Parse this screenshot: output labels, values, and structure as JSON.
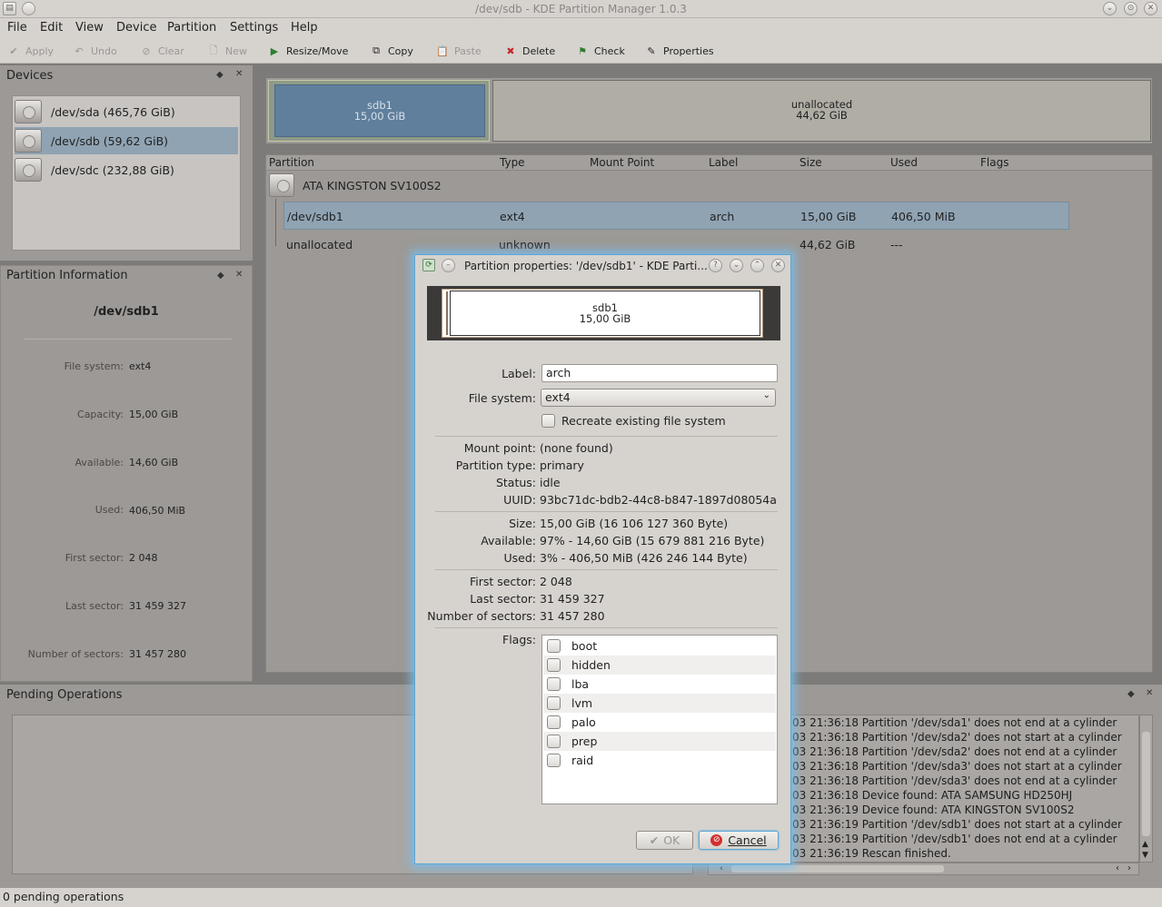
{
  "window": {
    "title": "/dev/sdb - KDE Partition Manager 1.0.3"
  },
  "menu": [
    "File",
    "Edit",
    "View",
    "Device",
    "Partition",
    "Settings",
    "Help"
  ],
  "toolbar": {
    "apply": "Apply",
    "undo": "Undo",
    "clear": "Clear",
    "new": "New",
    "resize": "Resize/Move",
    "copy": "Copy",
    "paste": "Paste",
    "delete": "Delete",
    "check": "Check",
    "properties": "Properties"
  },
  "devices": {
    "title": "Devices",
    "items": [
      "/dev/sda (465,76 GiB)",
      "/dev/sdb (59,62 GiB)",
      "/dev/sdc (232,88 GiB)"
    ]
  },
  "info": {
    "title": "Partition Information",
    "device": "/dev/sdb1",
    "rows": [
      {
        "label": "File system:",
        "value": "ext4"
      },
      {
        "label": "Capacity:",
        "value": "15,00 GiB"
      },
      {
        "label": "Available:",
        "value": "14,60 GiB"
      },
      {
        "label": "Used:",
        "value": "406,50 MiB"
      },
      {
        "label": "First sector:",
        "value": "2 048"
      },
      {
        "label": "Last sector:",
        "value": "31 459 327"
      },
      {
        "label": "Number of sectors:",
        "value": "31 457 280"
      }
    ]
  },
  "graph": {
    "p1_name": "sdb1",
    "p1_size": "15,00 GiB",
    "p2_name": "unallocated",
    "p2_size": "44,62 GiB"
  },
  "table": {
    "headers": [
      "Partition",
      "Type",
      "Mount Point",
      "Label",
      "Size",
      "Used",
      "Flags"
    ],
    "disk": "ATA KINGSTON SV100S2",
    "rows": [
      {
        "partition": "/dev/sdb1",
        "type": "ext4",
        "label": "arch",
        "size": "15,00 GiB",
        "used": "406,50 MiB"
      },
      {
        "partition": "unallocated",
        "type": "unknown",
        "label": "",
        "size": "44,62 GiB",
        "used": "---"
      }
    ]
  },
  "pending": {
    "title": "Pending Operations"
  },
  "log": [
    "03 21:36:18 Partition '/dev/sda1' does not end at a cylinder",
    "03 21:36:18 Partition '/dev/sda2' does not start at a cylinder",
    "03 21:36:18 Partition '/dev/sda2' does not end at a cylinder",
    "03 21:36:18 Partition '/dev/sda3' does not start at a cylinder",
    "03 21:36:18 Partition '/dev/sda3' does not end at a cylinder",
    "03 21:36:18 Device found: ATA SAMSUNG HD250HJ",
    "03 21:36:19 Device found: ATA KINGSTON SV100S2",
    "03 21:36:19 Partition '/dev/sdb1' does not start at a cylinder",
    "03 21:36:19 Partition '/dev/sdb1' does not end at a cylinder",
    "03 21:36:19 Rescan finished."
  ],
  "status": "0 pending operations",
  "dialog": {
    "title": "Partition properties: '/dev/sdb1' - KDE Parti...",
    "graph_name": "sdb1",
    "graph_size": "15,00 GiB",
    "label_label": "Label:",
    "label_value": "arch",
    "fs_label": "File system:",
    "fs_value": "ext4",
    "recreate": "Recreate existing file system",
    "rows1": [
      {
        "label": "Mount point:",
        "value": "(none found)"
      },
      {
        "label": "Partition type:",
        "value": "primary"
      },
      {
        "label": "Status:",
        "value": "idle"
      },
      {
        "label": "UUID:",
        "value": "93bc71dc-bdb2-44c8-b847-1897d08054a"
      }
    ],
    "rows2": [
      {
        "label": "Size:",
        "value": "15,00 GiB (16 106 127 360 Byte)"
      },
      {
        "label": "Available:",
        "value": "97% - 14,60 GiB (15 679 881 216 Byte)"
      },
      {
        "label": "Used:",
        "value": "3% - 406,50 MiB (426 246 144 Byte)"
      }
    ],
    "rows3": [
      {
        "label": "First sector:",
        "value": "2 048"
      },
      {
        "label": "Last sector:",
        "value": "31 459 327"
      },
      {
        "label": "Number of sectors:",
        "value": "31 457 280"
      }
    ],
    "flags_label": "Flags:",
    "flags": [
      "boot",
      "hidden",
      "lba",
      "lvm",
      "palo",
      "prep",
      "raid"
    ],
    "ok": "OK",
    "cancel": "Cancel"
  },
  "colors": {
    "accent": "#5aa7d5",
    "selection": "#8fa3b3",
    "partition_fill": "#5f7f9c"
  }
}
